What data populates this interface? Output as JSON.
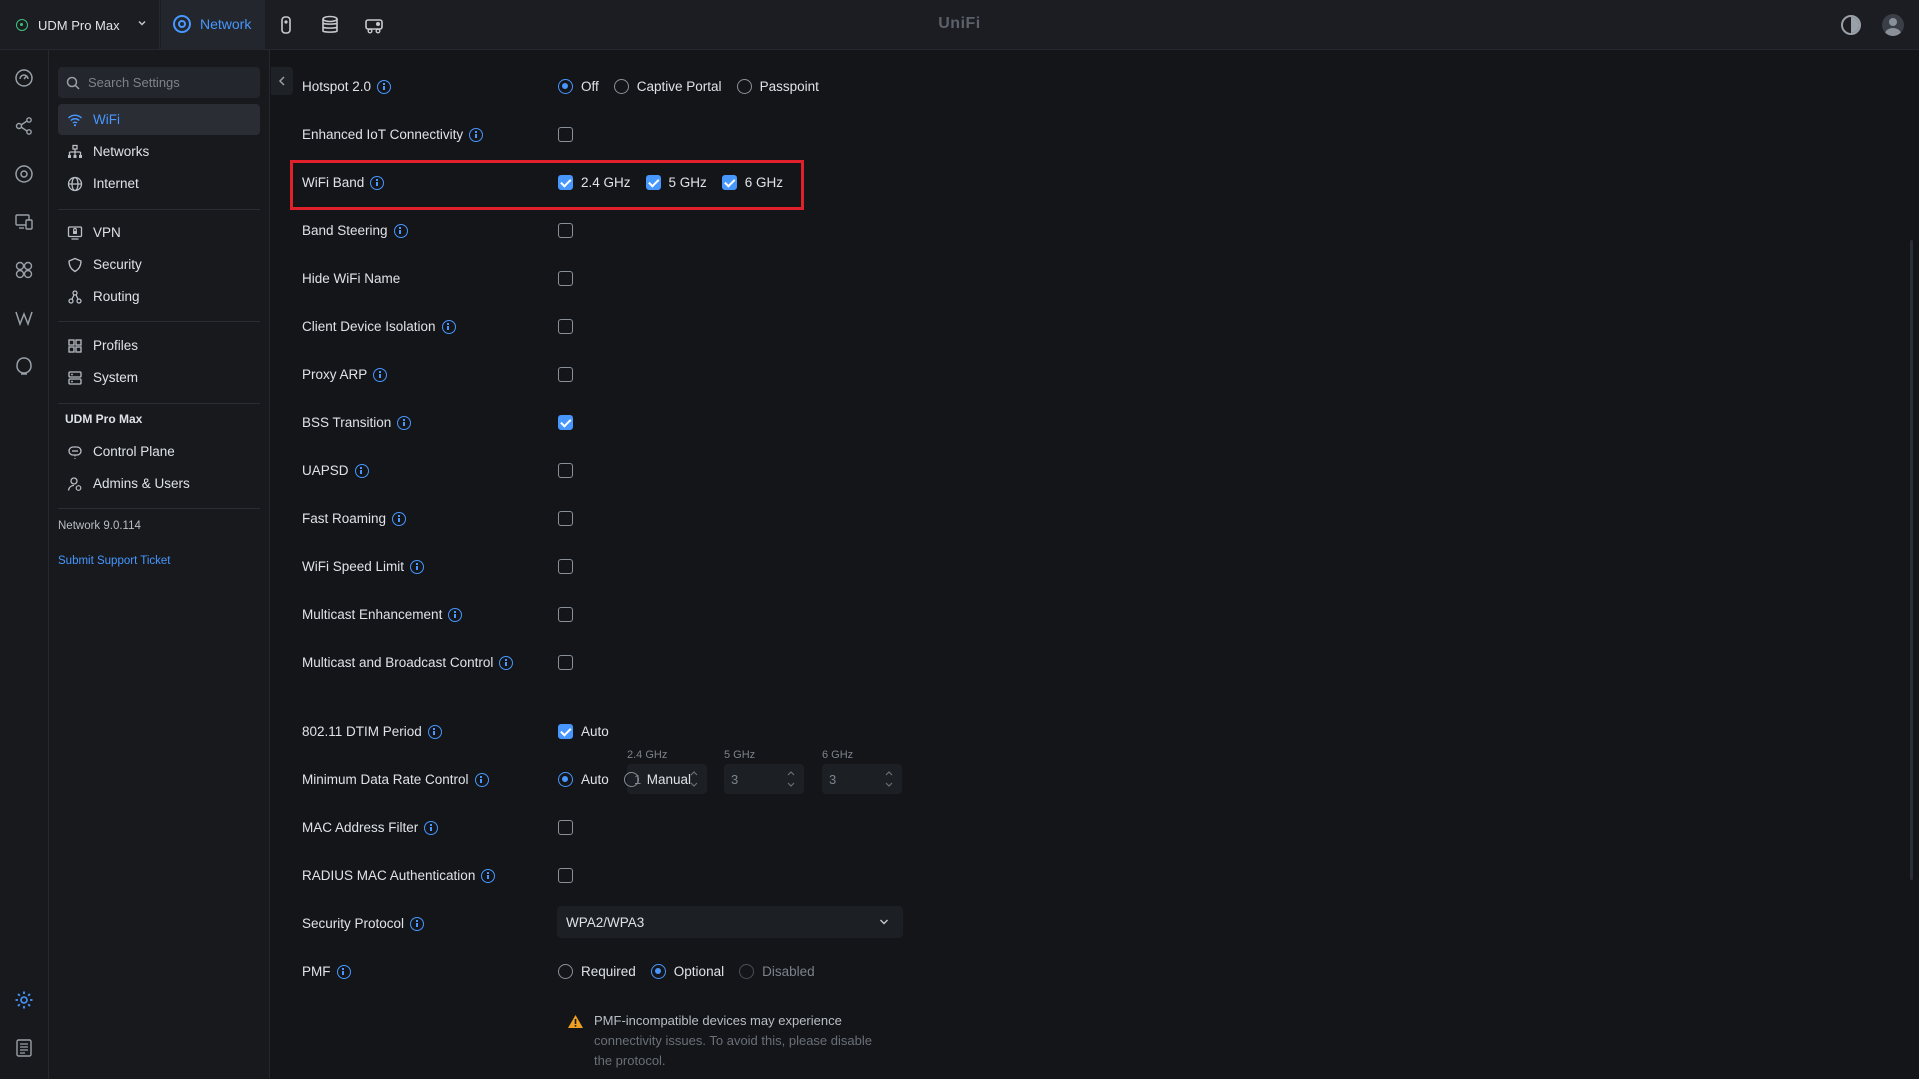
{
  "topbar": {
    "site_name": "UDM Pro Max",
    "app_tab": "Network",
    "brand": "UniFi"
  },
  "nav": {
    "search_placeholder": "Search Settings",
    "items": [
      {
        "label": "WiFi",
        "icon": "wifi-icon"
      },
      {
        "label": "Networks",
        "icon": "networks-icon"
      },
      {
        "label": "Internet",
        "icon": "globe-icon"
      },
      {
        "label": "VPN",
        "icon": "vpn-icon"
      },
      {
        "label": "Security",
        "icon": "shield-icon"
      },
      {
        "label": "Routing",
        "icon": "routing-icon"
      },
      {
        "label": "Profiles",
        "icon": "profiles-icon"
      },
      {
        "label": "System",
        "icon": "system-icon"
      }
    ],
    "device_heading": "UDM Pro Max",
    "device_items": [
      {
        "label": "Control Plane",
        "icon": "control-plane-icon"
      },
      {
        "label": "Admins & Users",
        "icon": "admins-icon"
      }
    ],
    "version": "Network 9.0.114",
    "support_link": "Submit Support Ticket"
  },
  "settings": {
    "hotspot": {
      "label": "Hotspot 2.0",
      "options": [
        "Off",
        "Captive Portal",
        "Passpoint"
      ],
      "selected": "Off"
    },
    "enhanced_iot": {
      "label": "Enhanced IoT Connectivity",
      "checked": false
    },
    "wifi_band": {
      "label": "WiFi Band",
      "options": [
        "2.4 GHz",
        "5 GHz",
        "6 GHz"
      ],
      "checked": [
        true,
        true,
        true
      ]
    },
    "band_steering": {
      "label": "Band Steering",
      "checked": false
    },
    "hide_wifi_name": {
      "label": "Hide WiFi Name",
      "checked": false
    },
    "client_isolation": {
      "label": "Client Device Isolation",
      "checked": false
    },
    "proxy_arp": {
      "label": "Proxy ARP",
      "checked": false
    },
    "bss_transition": {
      "label": "BSS Transition",
      "checked": true
    },
    "uapsd": {
      "label": "UAPSD",
      "checked": false
    },
    "fast_roaming": {
      "label": "Fast Roaming",
      "checked": false
    },
    "speed_limit": {
      "label": "WiFi Speed Limit",
      "checked": false
    },
    "multicast_enh": {
      "label": "Multicast Enhancement",
      "checked": false
    },
    "multicast_bcast": {
      "label": "Multicast and Broadcast Control",
      "checked": false
    },
    "dtim": {
      "label": "802.11 DTIM Period",
      "auto_label": "Auto",
      "auto_checked": true,
      "bands": [
        {
          "name": "2.4 GHz",
          "value": "1"
        },
        {
          "name": "5 GHz",
          "value": "3"
        },
        {
          "name": "6 GHz",
          "value": "3"
        }
      ]
    },
    "min_data_rate": {
      "label": "Minimum Data Rate Control",
      "options": [
        "Auto",
        "Manual"
      ],
      "selected": "Auto"
    },
    "mac_filter": {
      "label": "MAC Address Filter",
      "checked": false
    },
    "radius_mac": {
      "label": "RADIUS MAC Authentication",
      "checked": false
    },
    "security_protocol": {
      "label": "Security Protocol",
      "value": "WPA2/WPA3"
    },
    "pmf": {
      "label": "PMF",
      "options": [
        "Required",
        "Optional",
        "Disabled"
      ],
      "selected": "Optional"
    },
    "pmf_warning": {
      "line1": "PMF-incompatible devices may experience",
      "line2": "connectivity issues. To avoid this, please disable",
      "line3": "the protocol."
    }
  },
  "colors": {
    "accent": "#4797ff",
    "highlight": "#e0202a",
    "warning": "#f0a020"
  }
}
